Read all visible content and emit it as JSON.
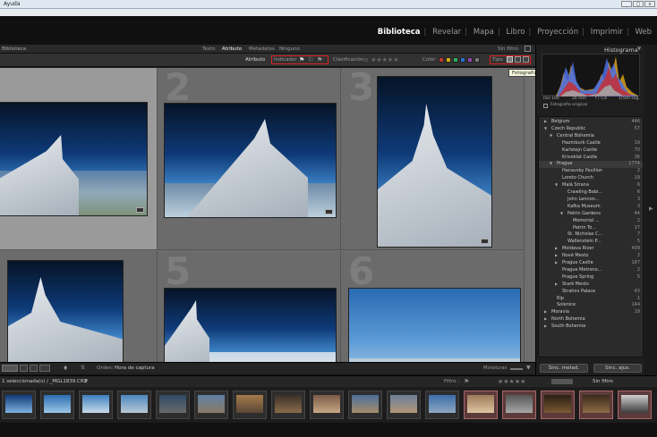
{
  "window": {
    "menu": "Ayuda"
  },
  "modules": {
    "items": [
      "Biblioteca",
      "Revelar",
      "Mapa",
      "Libro",
      "Proyección",
      "Imprimir",
      "Web"
    ],
    "active": "Biblioteca"
  },
  "filterbar": {
    "panel_label": "Biblioteca",
    "tabs": [
      "Texto",
      "Atributo",
      "Metadatos",
      "Ninguno"
    ],
    "active_tab": "Atributo",
    "no_filter": "Sin filtro",
    "attribute_label": "Atributo",
    "flagged_label": "Indicador",
    "rating_label": "Clasificación",
    "color_label": "Color",
    "type_label": "Tipo",
    "colors": [
      "#c0392b",
      "#d4ac0d",
      "#27ae60",
      "#2e6fd0",
      "#8e44ad",
      "#777777"
    ]
  },
  "tooltip": "Fotografías maestras",
  "histogram": {
    "iso": "ISO 100",
    "focal": "26 mm",
    "aperture": "f / 5,6",
    "shutter": "1/500 seg.",
    "caption": "Fotografía original",
    "header": "Histograma"
  },
  "grid": {
    "cells": [
      {
        "num": "",
        "selected": true
      },
      {
        "num": "2",
        "selected": false
      },
      {
        "num": "3",
        "selected": false
      },
      {
        "num": "",
        "selected": false
      },
      {
        "num": "5",
        "selected": false
      },
      {
        "num": "6",
        "selected": false
      }
    ]
  },
  "gridtoolbar": {
    "order_label": "Orden:",
    "order_value": "Hora de captura",
    "thumbnails_label": "Miniaturas"
  },
  "keywords": [
    {
      "label": "Belgium",
      "count": "446",
      "indent": 2,
      "arrow": "▶"
    },
    {
      "label": "Czech Republic",
      "count": "57",
      "indent": 2,
      "arrow": "▼"
    },
    {
      "label": "Central Bohemia",
      "count": "",
      "indent": 3,
      "arrow": "▼"
    },
    {
      "label": "Hazmburk Castle",
      "count": "19",
      "indent": 4,
      "arrow": ""
    },
    {
      "label": "Karlstejn Castle",
      "count": "70",
      "indent": 4,
      "arrow": ""
    },
    {
      "label": "Krivoklat Castle",
      "count": "36",
      "indent": 4,
      "arrow": ""
    },
    {
      "label": "Prague",
      "count": "1774",
      "indent": 3,
      "arrow": "▼"
    },
    {
      "label": "Hanavsky Pavilion",
      "count": "2",
      "indent": 4,
      "arrow": ""
    },
    {
      "label": "Loreto Church",
      "count": "19",
      "indent": 4,
      "arrow": ""
    },
    {
      "label": "Malá Strana",
      "count": "6",
      "indent": 4,
      "arrow": "▼"
    },
    {
      "label": "Crawling Babi...",
      "count": "6",
      "indent": 5,
      "arrow": ""
    },
    {
      "label": "John Lennon...",
      "count": "3",
      "indent": 5,
      "arrow": ""
    },
    {
      "label": "Kafka Museum",
      "count": "3",
      "indent": 5,
      "arrow": ""
    },
    {
      "label": "Petrin Gardens",
      "count": "44",
      "indent": 5,
      "arrow": "▼"
    },
    {
      "label": "Memorial ...",
      "count": "2",
      "indent": 6,
      "arrow": ""
    },
    {
      "label": "Petrin To...",
      "count": "17",
      "indent": 6,
      "arrow": ""
    },
    {
      "label": "St. Nicholas C...",
      "count": "7",
      "indent": 5,
      "arrow": ""
    },
    {
      "label": "Wallenstein P...",
      "count": "5",
      "indent": 5,
      "arrow": ""
    },
    {
      "label": "Moldava River",
      "count": "409",
      "indent": 4,
      "arrow": "▶"
    },
    {
      "label": "Nové Mesto",
      "count": "2",
      "indent": 4,
      "arrow": "▶"
    },
    {
      "label": "Prague Castle",
      "count": "187",
      "indent": 4,
      "arrow": "▶"
    },
    {
      "label": "Prague Metrono...",
      "count": "2",
      "indent": 4,
      "arrow": ""
    },
    {
      "label": "Prague Spring",
      "count": "5",
      "indent": 4,
      "arrow": ""
    },
    {
      "label": "Staré Mesto",
      "count": "",
      "indent": 4,
      "arrow": "▶"
    },
    {
      "label": "Strahov Palace",
      "count": "43",
      "indent": 4,
      "arrow": ""
    },
    {
      "label": "Rip",
      "count": "1",
      "indent": 3,
      "arrow": ""
    },
    {
      "label": "Solenice",
      "count": "144",
      "indent": 3,
      "arrow": ""
    },
    {
      "label": "Moravia",
      "count": "19",
      "indent": 2,
      "arrow": "▶"
    },
    {
      "label": "North Bohemia",
      "count": "",
      "indent": 2,
      "arrow": "▶"
    },
    {
      "label": "South Bohemia",
      "count": "",
      "indent": 2,
      "arrow": "▶"
    }
  ],
  "right_buttons": {
    "sync_meta": "Sinc. metad.",
    "sync_settings": "Sinc. ajus."
  },
  "filmstrip": {
    "selection_text": "1 seleccionada(s) / _MGL1839.CR2",
    "filter_label": "Filtro :",
    "filter_value": "Sin filtro"
  }
}
